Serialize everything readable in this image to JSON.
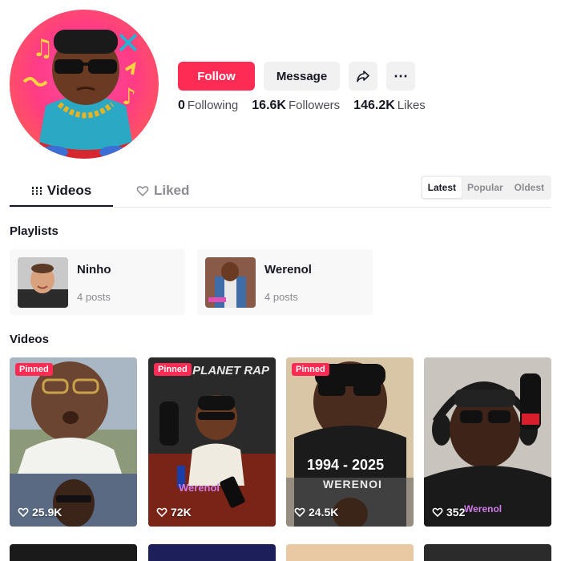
{
  "header": {
    "follow_label": "Follow",
    "message_label": "Message",
    "share_icon": "share-icon",
    "more_icon": "more-icon",
    "more_glyph": "⋯"
  },
  "stats": [
    {
      "value": "0",
      "label": "Following"
    },
    {
      "value": "16.6K",
      "label": "Followers"
    },
    {
      "value": "146.2K",
      "label": "Likes"
    }
  ],
  "tabs": {
    "videos_label": "Videos",
    "liked_label": "Liked"
  },
  "sort": [
    "Latest",
    "Popular",
    "Oldest"
  ],
  "playlists": {
    "title": "Playlists",
    "items": [
      {
        "name": "Ninho",
        "count": "4 posts"
      },
      {
        "name": "Werenol",
        "count": "4 posts"
      }
    ]
  },
  "videos": {
    "title": "Videos",
    "pinned_label": "Pinned",
    "items": [
      {
        "views": "25.9K",
        "pinned": true
      },
      {
        "views": "72K",
        "pinned": true,
        "caption": "Werenol"
      },
      {
        "views": "24.5K",
        "pinned": true,
        "caption": "1994 - 2025",
        "caption2": "WERENOI"
      },
      {
        "views": "352",
        "pinned": false,
        "caption": "Werenol"
      }
    ],
    "watermark": "PLANET RAP"
  },
  "colors": {
    "accent": "#fe2c55",
    "button_bg": "#f1f1f2",
    "muted": "#8a8b91"
  }
}
